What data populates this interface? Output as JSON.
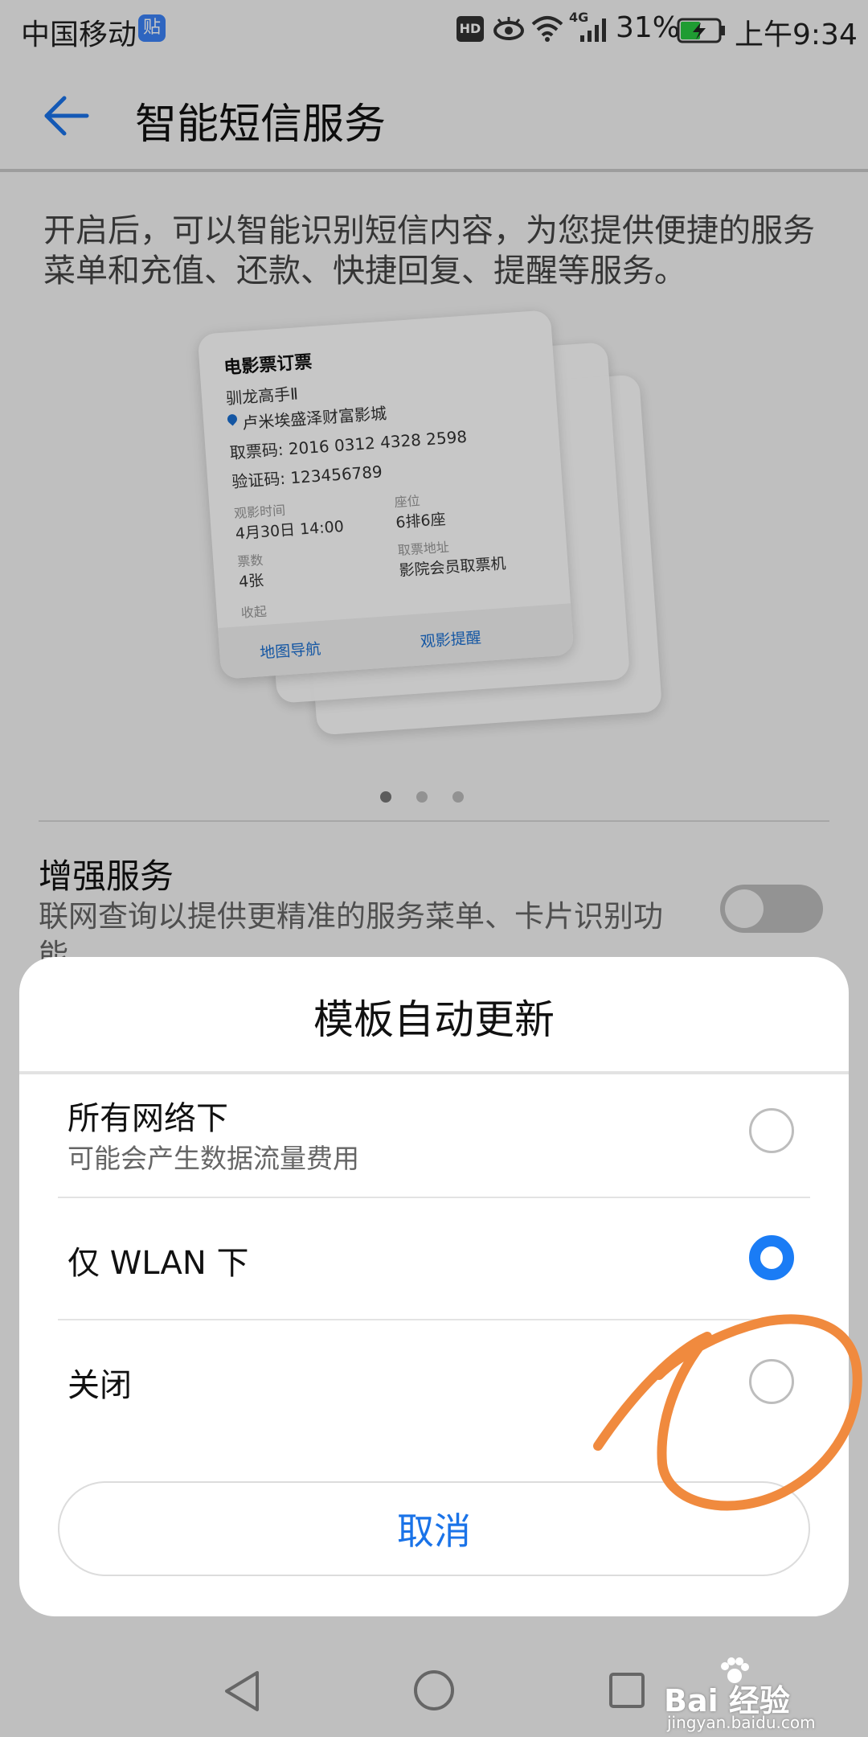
{
  "status_bar": {
    "carrier": "中国移动",
    "badge": "贴",
    "hd": "HD",
    "network": "4G",
    "battery": "31%",
    "time": "上午9:34"
  },
  "header": {
    "back_icon": "arrow-left-icon",
    "title": "智能短信服务"
  },
  "description": "开启后，可以智能识别短信内容，为您提供便捷的服务菜单和充值、还款、快捷回复、提醒等服务。",
  "sample_card": {
    "heading": "电影票订票",
    "movie": "驯龙高手Ⅱ",
    "cinema": "卢米埃盛泽财富影城",
    "ticket_code": "取票码: 2016 0312 4328 2598",
    "verify_code": "验证码: 123456789",
    "time_label": "观影时间",
    "time_value": "4月30日 14:00",
    "seat_label": "座位",
    "seat_value": "6排6座",
    "count_label": "票数",
    "count_value": "4张",
    "pickup_label": "取票地址",
    "pickup_value": "影院会员取票机",
    "collapse": "收起",
    "action_nav": "地图导航",
    "action_remind": "观影提醒"
  },
  "pager": {
    "active_index": 0,
    "count": 3
  },
  "enhanced_service": {
    "title": "增强服务",
    "subtitle": "联网查询以提供更精准的服务菜单、卡片识别功能",
    "enabled": false
  },
  "dialog": {
    "title": "模板自动更新",
    "options": [
      {
        "label": "所有网络下",
        "sub": "可能会产生数据流量费用",
        "selected": false
      },
      {
        "label": "仅 WLAN 下",
        "sub": "",
        "selected": true
      },
      {
        "label": "关闭",
        "sub": "",
        "selected": false
      }
    ],
    "cancel_label": "取消"
  },
  "colors": {
    "accent": "#1a7cf5",
    "annotation": "#f08a3e"
  },
  "watermark": {
    "brand": "Bai 经验",
    "url": "jingyan.baidu.com"
  }
}
